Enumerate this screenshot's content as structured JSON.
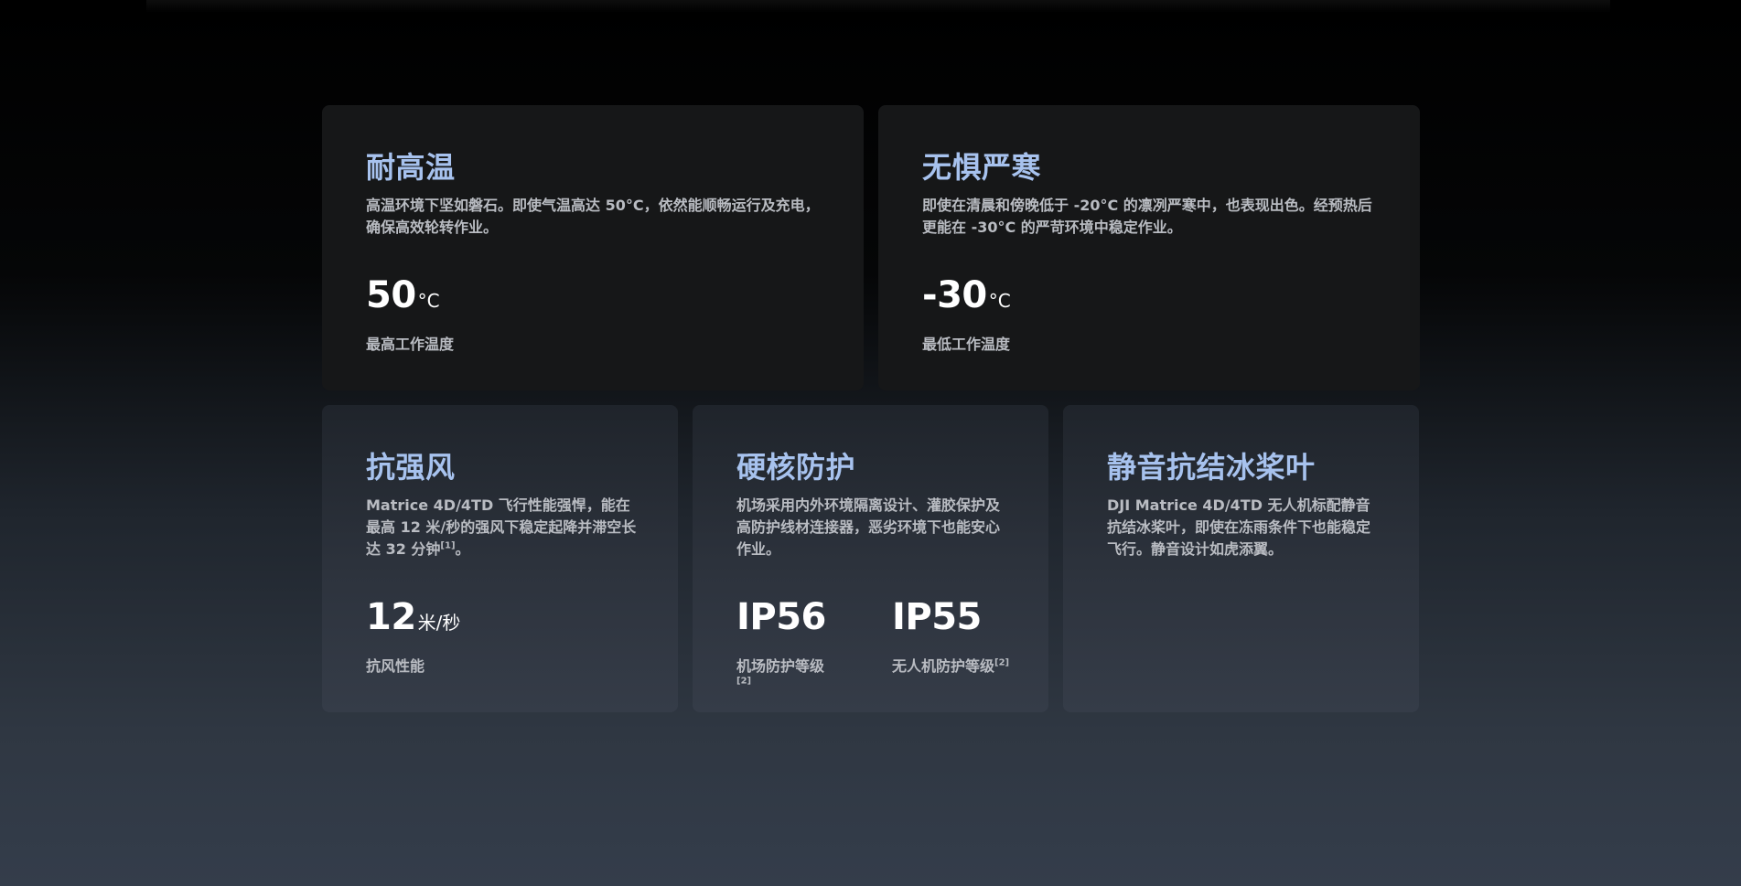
{
  "cards": [
    {
      "title": "耐高温",
      "desc": "高温环境下坚如磐石。即使气温高达 50°C，依然能顺畅运行及充电，确保高效轮转作业。",
      "stats": [
        {
          "value": "50",
          "unit": "°C",
          "label": "最高工作温度",
          "note": ""
        }
      ]
    },
    {
      "title": "无惧严寒",
      "desc": "即使在清晨和傍晚低于 -20°C 的凛冽严寒中，也表现出色。经预热后更能在 -30°C 的严苛环境中稳定作业。",
      "stats": [
        {
          "value": "-30",
          "unit": "°C",
          "label": "最低工作温度",
          "note": ""
        }
      ]
    },
    {
      "title": "抗强风",
      "desc": "Matrice 4D/4TD 飞行性能强悍，能在最高 12 米/秒的强风下稳定起降并滞空长达 32 分钟",
      "desc_note": "[1]",
      "desc_tail": "。",
      "stats": [
        {
          "value": "12",
          "unit": "米/秒",
          "label": "抗风性能",
          "note": ""
        }
      ]
    },
    {
      "title": "硬核防护",
      "desc": "机场采用内外环境隔离设计、灌胶保护及高防护线材连接器，恶劣环境下也能安心作业。",
      "stats": [
        {
          "value": "IP56",
          "unit": "",
          "label": "机场防护等级",
          "note": "[2]"
        },
        {
          "value": "IP55",
          "unit": "",
          "label": "无人机防护等级",
          "note": "[2]"
        }
      ]
    },
    {
      "title": "静音抗结冰桨叶",
      "desc": "DJI Matrice 4D/4TD 无人机标配静音抗结冰桨叶，即使在冻雨条件下也能稳定飞行。静音设计如虎添翼。",
      "stats": []
    }
  ]
}
